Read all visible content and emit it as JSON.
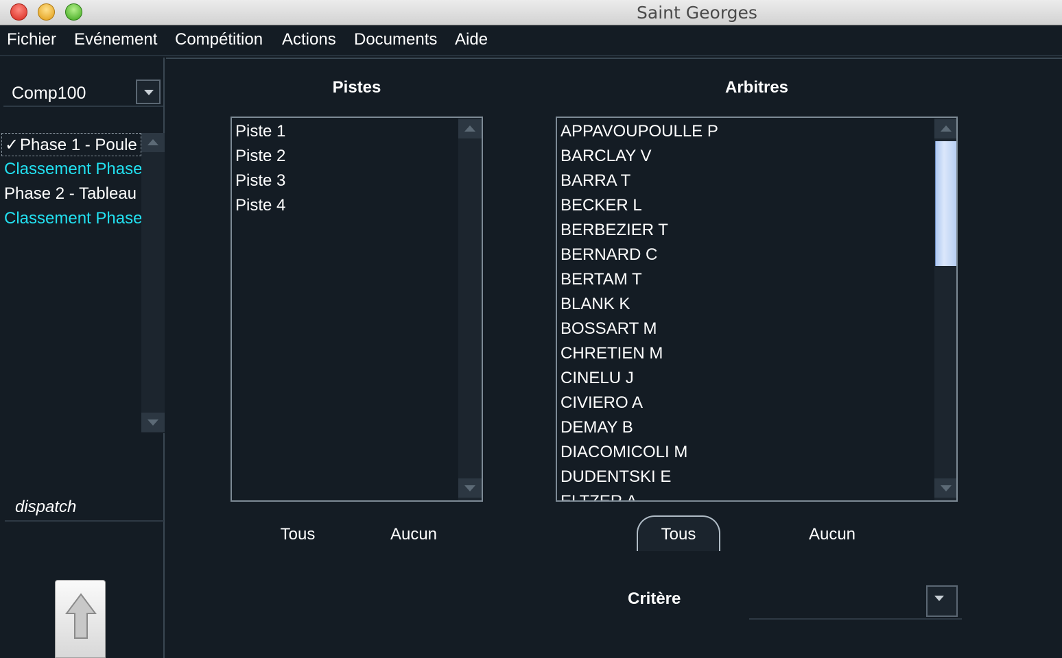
{
  "window": {
    "title": "Saint Georges"
  },
  "menu": [
    "Fichier",
    "Evénement",
    "Compétition",
    "Actions",
    "Documents",
    "Aide"
  ],
  "sidebar": {
    "competition": {
      "value": "Comp100"
    },
    "phases": [
      {
        "label": "Phase 1 - Poule",
        "checked": true,
        "color": "#ffffff"
      },
      {
        "label": "Classement Phase",
        "checked": false,
        "color": "#22e0f0"
      },
      {
        "label": "Phase 2 - Tableau",
        "checked": false,
        "color": "#ffffff"
      },
      {
        "label": "Classement Phase",
        "checked": false,
        "color": "#22e0f0"
      }
    ],
    "dispatch_label": "dispatch",
    "up_icon": "up-arrow-icon"
  },
  "pistes": {
    "title": "Pistes",
    "items": [
      "Piste 1",
      "Piste 2",
      "Piste 3",
      "Piste 4"
    ],
    "all_label": "Tous",
    "none_label": "Aucun"
  },
  "arbitres": {
    "title": "Arbitres",
    "items": [
      "APPAVOUPOULLE P",
      "BARCLAY V",
      "BARRA T",
      "BECKER L",
      "BERBEZIER T",
      "BERNARD C",
      "BERTAM T",
      "BLANK K",
      "BOSSART M",
      "CHRETIEN M",
      "CINELU J",
      "CIVIERO A",
      "DEMAY B",
      "DIACOMICOLI M",
      "DUDENTSKI E",
      "ELTZER A"
    ],
    "all_label": "Tous",
    "none_label": "Aucun"
  },
  "critere": {
    "label": "Critère",
    "value": ""
  },
  "colors": {
    "background": "#141c24",
    "accent_cyan": "#22e0f0",
    "scroll_thumb": "#c8daf8"
  }
}
